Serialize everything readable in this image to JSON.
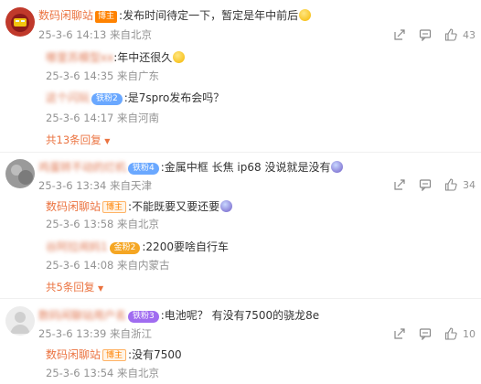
{
  "comments": [
    {
      "username": "数码闲聊站",
      "badge": "博主",
      "text": ":发布时间待定一下，暂定是年中前后",
      "date": "25-3-6 14:13",
      "location": "来自北京",
      "likes": "43",
      "replies": [
        {
          "username": "哪里苏模型xx",
          "text": ":年中还很久",
          "date": "25-3-6 14:35",
          "location": "来自广东"
        },
        {
          "username": "这个闪玩",
          "badge": "铁粉2",
          "text": ":是7spro发布会吗？",
          "date": "25-3-6 14:17",
          "location": "来自河南"
        }
      ],
      "more_replies": "共13条回复"
    },
    {
      "username": "鸡蛋转不动的烂机",
      "badge": "铁粉4",
      "text": ":金属中框 长焦 ip68 没说就是没有",
      "date": "25-3-6 13:34",
      "location": "来自天津",
      "likes": "34",
      "replies": [
        {
          "username": "数码闲聊站",
          "badge": "博主",
          "text": ":不能既要又要还要",
          "date": "25-3-6 13:58",
          "location": "来自北京"
        },
        {
          "username": "谷阿拉闹妈1",
          "badge": "金粉2",
          "text": ":2200要啥自行车",
          "date": "25-3-6 14:08",
          "location": "来自内蒙古"
        }
      ],
      "more_replies": "共5条回复"
    },
    {
      "username": "数码闲聊站用户名",
      "badge": "铁粉3",
      "text": ":电池呢？ 有没有7500的骁龙8e",
      "date": "25-3-6 13:39",
      "location": "来自浙江",
      "likes": "10",
      "replies": [
        {
          "username": "数码闲聊站",
          "badge": "博主",
          "text": ":没有7500",
          "date": "25-3-6 13:54",
          "location": "来自北京"
        }
      ]
    }
  ]
}
